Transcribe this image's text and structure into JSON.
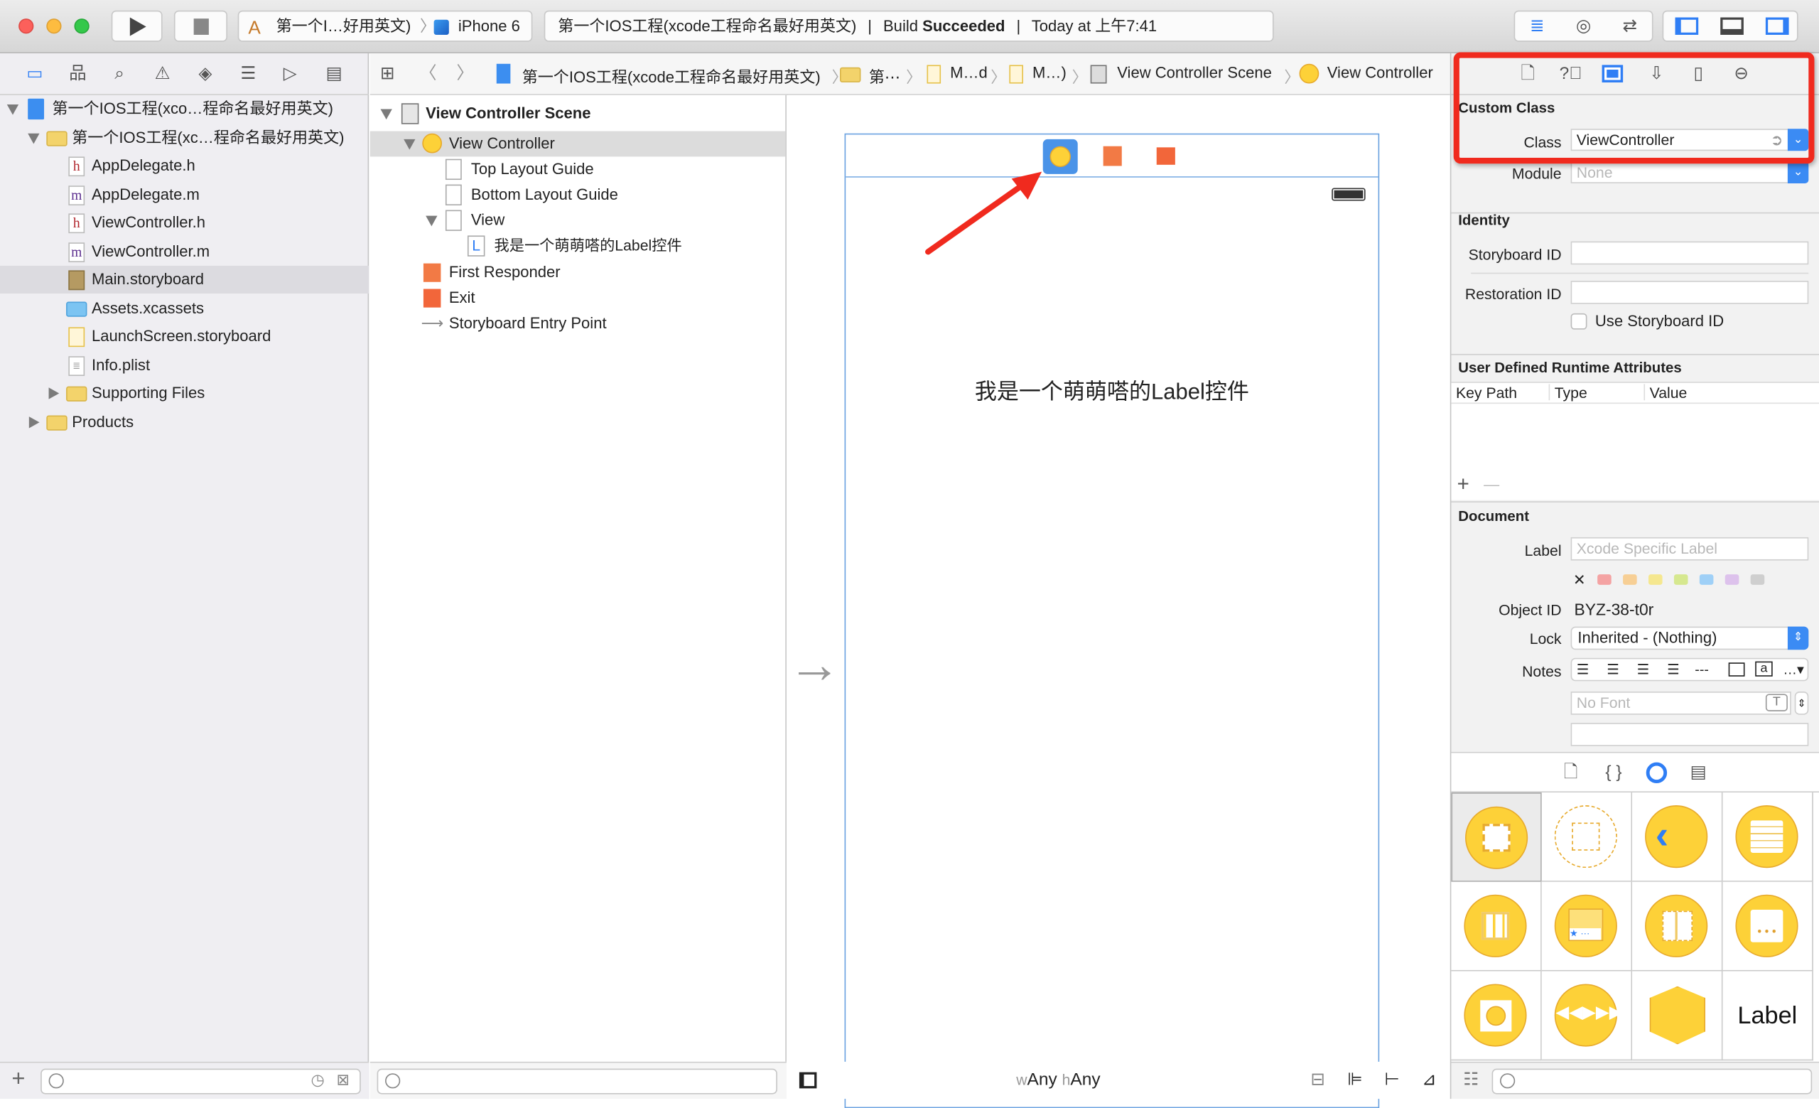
{
  "toolbar": {
    "run_icon": "play-icon",
    "stop_icon": "stop-icon",
    "scheme": "第一个I…好用英文)",
    "device": "iPhone 6",
    "status_project": "第一个IOS工程(xcode工程命名最好用英文)",
    "status_build_prefix": "Build ",
    "status_build_result": "Succeeded",
    "status_time": "Today at 上午7:41",
    "separator": "|"
  },
  "navigator": {
    "tab_icons": [
      "folder-icon",
      "hierarchy-icon",
      "search-icon",
      "warning-icon",
      "test-diamond-icon",
      "debug-list-icon",
      "breakpoint-icon",
      "report-icon"
    ],
    "items": [
      {
        "label": "第一个IOS工程(xco…程命名最好用英文)",
        "icon": "project-icon",
        "expanded": true
      },
      {
        "label": "第一个IOS工程(xc…程命名最好用英文)",
        "icon": "folder-icon",
        "expanded": true
      },
      {
        "label": "AppDelegate.h",
        "icon": "h"
      },
      {
        "label": "AppDelegate.m",
        "icon": "m"
      },
      {
        "label": "ViewController.h",
        "icon": "h"
      },
      {
        "label": "ViewController.m",
        "icon": "m"
      },
      {
        "label": "Main.storyboard",
        "icon": "storyboard-icon",
        "selected": true
      },
      {
        "label": "Assets.xcassets",
        "icon": "assets-folder-icon"
      },
      {
        "label": "LaunchScreen.storyboard",
        "icon": "storyboard-icon"
      },
      {
        "label": "Info.plist",
        "icon": "plist-icon"
      },
      {
        "label": "Supporting Files",
        "icon": "folder-icon",
        "expanded": false
      },
      {
        "label": "Products",
        "icon": "folder-icon",
        "expanded": false
      }
    ]
  },
  "jumpbar": {
    "crumbs": [
      "第一个IOS工程(xcode工程命名最好用英文)",
      "第⋯",
      "M…d",
      "M…)",
      "View Controller Scene",
      "View Controller"
    ]
  },
  "outline": {
    "scene": "View Controller Scene",
    "items": [
      "View Controller",
      "Top Layout Guide",
      "Bottom Layout Guide",
      "View",
      "我是一个萌萌嗒的Label控件",
      "First Responder",
      "Exit",
      "Storyboard Entry Point"
    ]
  },
  "canvas": {
    "label_text": "我是一个萌萌嗒的Label控件",
    "size_class_w_prefix": "w",
    "size_class_w": "Any",
    "size_class_h_prefix": "h",
    "size_class_h": "Any"
  },
  "inspector": {
    "custom_class": {
      "title": "Custom Class",
      "class_label": "Class",
      "class_value": "ViewController",
      "module_label": "Module",
      "module_placeholder": "None"
    },
    "identity": {
      "title": "Identity",
      "storyboard_id_label": "Storyboard ID",
      "storyboard_id_value": "",
      "restoration_id_label": "Restoration ID",
      "restoration_id_value": "",
      "use_storyboard_id_label": "Use Storyboard ID",
      "use_storyboard_id_checked": false
    },
    "runtime_attributes": {
      "title": "User Defined Runtime Attributes",
      "columns": [
        "Key Path",
        "Type",
        "Value"
      ],
      "add": "+",
      "remove": "—"
    },
    "document": {
      "title": "Document",
      "label_label": "Label",
      "label_placeholder": "Xcode Specific Label",
      "clear": "✕",
      "swatches": [
        "#f4a3a3",
        "#f7cf95",
        "#f5e78f",
        "#d6e88f",
        "#9fd0f7",
        "#ddc2ec",
        "#cfcfcf"
      ],
      "object_id_label": "Object ID",
      "object_id": "BYZ-38-t0r",
      "lock_label": "Lock",
      "lock_value": "Inherited - (Nothing)",
      "notes_label": "Notes",
      "font_placeholder": "No Font"
    }
  },
  "library": {
    "tab_icons": [
      "file-template-icon",
      "code-snippet-icon",
      "object-library-icon",
      "media-library-icon"
    ],
    "label_item": "Label"
  },
  "colors": {
    "accent": "#2f7ef5",
    "annotation": "#f02a1e",
    "object_yellow": "#fdd138"
  }
}
